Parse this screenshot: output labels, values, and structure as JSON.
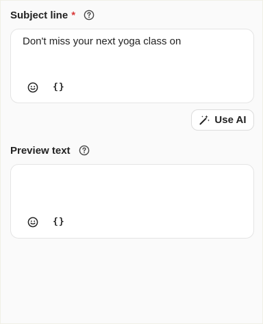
{
  "subject": {
    "label": "Subject line",
    "required_mark": "*",
    "value": "Don't miss your next yoga class on",
    "braces": "{}"
  },
  "use_ai": {
    "label": "Use AI"
  },
  "preview": {
    "label": "Preview text",
    "value": "",
    "braces": "{}"
  },
  "icons": {
    "help": "help-circle-icon",
    "emoji": "smiley-icon",
    "variables": "braces-icon",
    "ai": "magic-wand-icon"
  },
  "colors": {
    "required": "#d93a3a",
    "text": "#222222",
    "border": "#e4e4e4",
    "background": "#fafafa"
  }
}
